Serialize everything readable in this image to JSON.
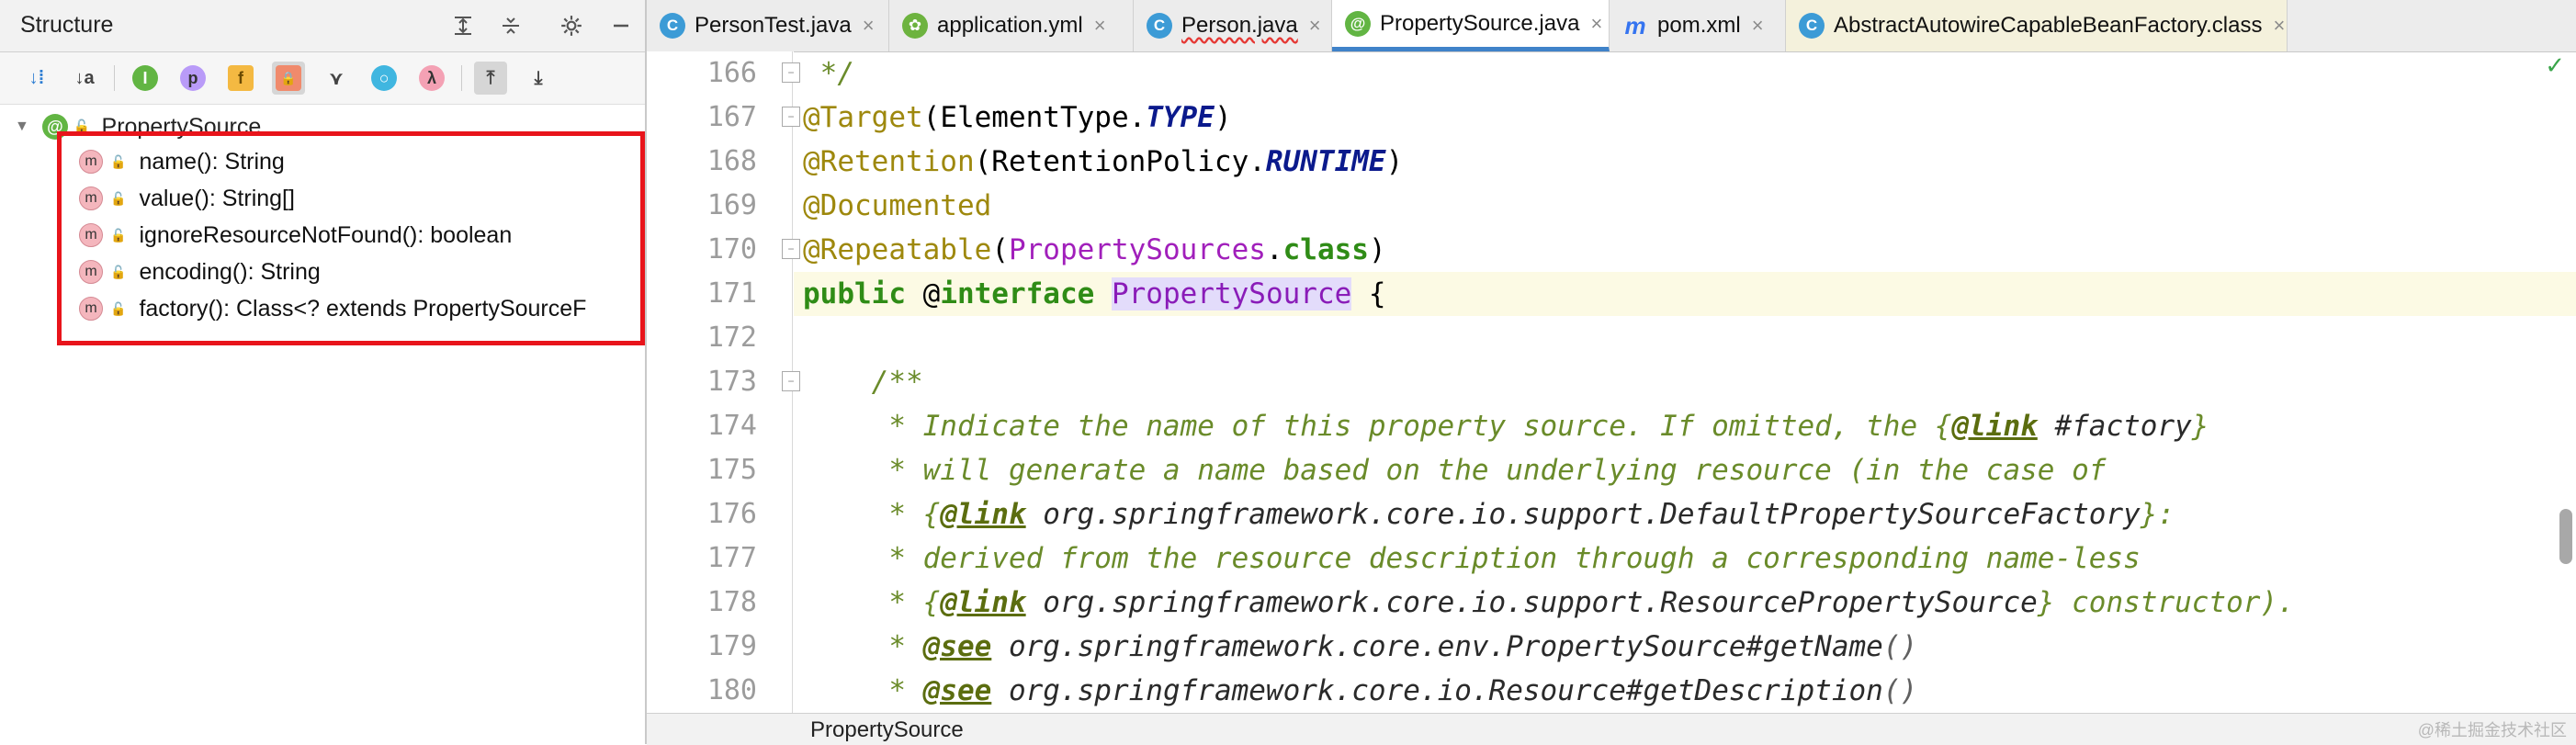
{
  "structure_panel": {
    "title": "Structure",
    "header_icons": [
      "expand-all-icon",
      "collapse-all-icon",
      "gear-icon",
      "minimize-icon"
    ],
    "toolbar": {
      "sort_by_visibility": "↓⁞",
      "sort_alpha": "↓a",
      "show_inherited": "I",
      "show_properties": "p",
      "show_fields": "f",
      "show_non_public": "🔒",
      "show_anonymous": "⋎",
      "show_lambdas": "λ",
      "autoscroll_to_source": "⤒",
      "autoscroll_from_source": "⤓"
    },
    "root": {
      "icon": "@",
      "label": "PropertySource"
    },
    "items": [
      {
        "icon": "m",
        "label": "name(): String"
      },
      {
        "icon": "m",
        "label": "value(): String[]"
      },
      {
        "icon": "m",
        "label": "ignoreResourceNotFound(): boolean"
      },
      {
        "icon": "m",
        "label": "encoding(): String"
      },
      {
        "icon": "m",
        "label": "factory(): Class<? extends PropertySourceF"
      }
    ]
  },
  "tabs": [
    {
      "icon": "C",
      "label": "PersonTest.java",
      "close": "×"
    },
    {
      "icon": "✿",
      "label": "application.yml",
      "close": "×"
    },
    {
      "icon": "C",
      "label": "Person.java",
      "close": "×"
    },
    {
      "icon": "@",
      "label": "PropertySource.java",
      "close": "×"
    },
    {
      "icon": "m",
      "label": "pom.xml",
      "close": "×"
    },
    {
      "icon": "C",
      "label": "AbstractAutowireCapableBeanFactory.class",
      "close": "×"
    }
  ],
  "editor": {
    "line_numbers": [
      "166",
      "167",
      "168",
      "169",
      "170",
      "171",
      "172",
      "173",
      "174",
      "175",
      "176",
      "177",
      "178",
      "179",
      "180"
    ],
    "lines": {
      "l166": " */",
      "l167_anno": "@Target",
      "l167_a": "(ElementType.",
      "l167_b": "TYPE",
      "l167_c": ")",
      "l168_anno": "@Retention",
      "l168_a": "(RetentionPolicy.",
      "l168_b": "RUNTIME",
      "l168_c": ")",
      "l169_anno": "@Documented",
      "l170_anno": "@Repeatable",
      "l170_a": "(",
      "l170_b": "PropertySources",
      "l170_c": ".",
      "l170_d": "class",
      "l170_e": ")",
      "l171_a": "public",
      "l171_b": " @",
      "l171_c": "interface",
      "l171_d": " ",
      "l171_e": "PropertySource",
      "l171_f": " {",
      "l173": "    /**",
      "l174_a": "     * Indicate the name of this property source. If omitted, the {",
      "l174_tag": "@link",
      "l174_b": " #factory",
      "l174_c": "}",
      "l175": "     * will generate a name based on the underlying resource (in the case of",
      "l176_a": "     * {",
      "l176_tag": "@link",
      "l176_b": " org.springframework.core.io.support.DefaultPropertySourceFactory",
      "l176_c": "}:",
      "l177": "     * derived from the resource description through a corresponding name-less",
      "l178_a": "     * {",
      "l178_tag": "@link",
      "l178_b": " org.springframework.core.io.support.ResourcePropertySource",
      "l178_c": "} constructor).",
      "l179_a": "     * ",
      "l179_tag": "@see",
      "l179_b": " org.springframework.core.env.PropertySource",
      "l179_c": "#getName",
      "l179_d": "()",
      "l180_a": "     * ",
      "l180_tag": "@see",
      "l180_b": " org.springframework.core.io.Resource",
      "l180_c": "#getDescription",
      "l180_d": "()"
    }
  },
  "status_bar": {
    "breadcrumb": "PropertySource",
    "watermark": "@稀土掘金技术社区"
  },
  "analysis_ok_icon": "✓",
  "colors": {
    "highlight_box": "#e8141b",
    "active_tab_underline": "#4083c9",
    "current_line_bg": "#fcfae4"
  }
}
